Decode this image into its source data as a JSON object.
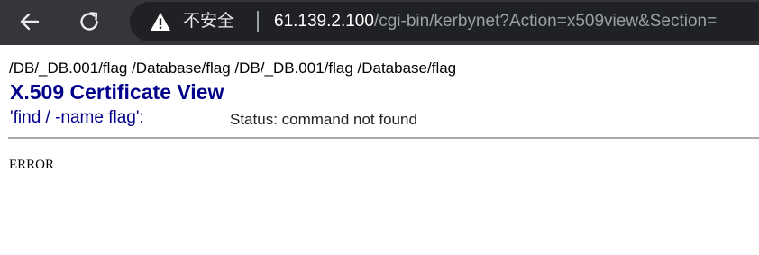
{
  "browser": {
    "back_icon": "arrow-left-icon",
    "reload_icon": "reload-icon",
    "warning_icon": "warning-triangle-icon",
    "security_label": "不安全",
    "url_host": "61.139.2.100",
    "url_path": "/cgi-bin/kerbynet?Action=x509view&Section=",
    "colors": {
      "toolbar": "#35363a",
      "omnibox": "#202124",
      "url_host": "#ffffff",
      "url_path": "#9aa0a6"
    }
  },
  "page": {
    "path_line": "/DB/_DB.001/flag /Database/flag /DB/_DB.001/flag /Database/flag",
    "title": "X.509 Certificate View",
    "command_label": "'find / -name flag':",
    "status_text": "Status: command not found",
    "error_text": "ERROR",
    "colors": {
      "title": "#00008b",
      "command_label": "#00008b",
      "rule": "#a9a9a9"
    }
  }
}
